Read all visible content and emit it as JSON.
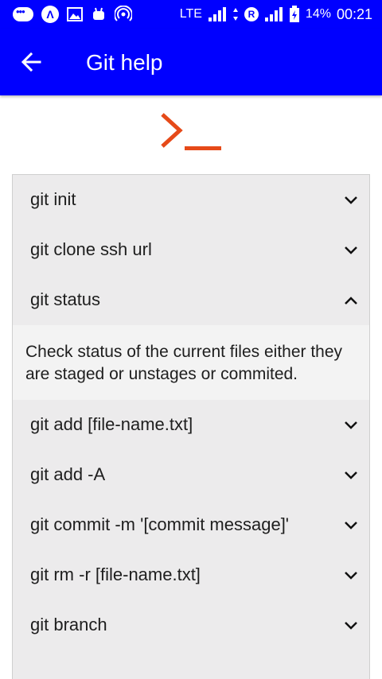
{
  "status_bar": {
    "network": "LTE",
    "battery": "14%",
    "time": "00:21",
    "icons": [
      "messages-icon",
      "app-icon",
      "gallery-icon",
      "android-icon",
      "hotspot-icon",
      "signal-icon",
      "data-icon",
      "roaming-icon",
      "signal-icon-2",
      "battery-charging-icon"
    ]
  },
  "app_bar": {
    "title": "Git help",
    "back_icon": "arrow-left-icon"
  },
  "logo": {
    "icon": "terminal-prompt-icon",
    "color": "#e64a19"
  },
  "commands": [
    {
      "label": "git init",
      "expanded": false
    },
    {
      "label": "git clone ssh url",
      "expanded": false
    },
    {
      "label": "git status",
      "expanded": true,
      "description": "Check status of the current files either they are staged or unstages or commited."
    },
    {
      "label": "git add [file-name.txt]",
      "expanded": false
    },
    {
      "label": "git add -A",
      "expanded": false
    },
    {
      "label": "git commit -m '[commit message]'",
      "expanded": false
    },
    {
      "label": "git rm -r [file-name.txt]",
      "expanded": false
    },
    {
      "label": "git branch",
      "expanded": false
    }
  ],
  "colors": {
    "primary": "#0000ff",
    "row_bg": "#ecebec",
    "detail_bg": "#f3f3f3",
    "accent": "#e64a19"
  }
}
